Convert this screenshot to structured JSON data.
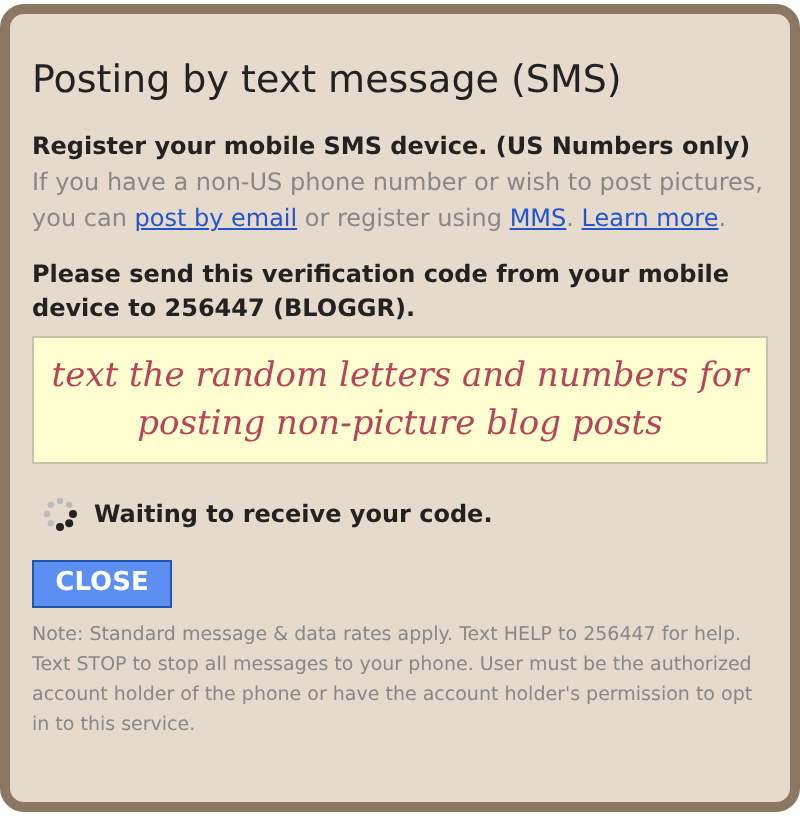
{
  "dialog": {
    "title": "Posting by text message (SMS)",
    "heading": "Register your mobile SMS device. (US Numbers only)",
    "intro": [
      {
        "kind": "text",
        "text": "If you have a non-US phone number or wish to post pictures, you can "
      },
      {
        "kind": "link",
        "text": "post by email"
      },
      {
        "kind": "text",
        "text": " or register using "
      },
      {
        "kind": "link",
        "text": "MMS"
      },
      {
        "kind": "text",
        "text": ". "
      },
      {
        "kind": "link",
        "text": "Learn more"
      },
      {
        "kind": "text",
        "text": "."
      }
    ],
    "instruction": "Please send this verification code from your mobile device to 256447 (BLOGGR).",
    "code_box": {
      "annotation": "text the random letters and numbers for posting non-picture blog posts"
    },
    "status": "Waiting to receive your code.",
    "close_button": "CLOSE",
    "note": "Note: Standard message & data rates apply. Text HELP to 256447 for help. Text STOP to stop all messages to your phone. User must be the authorized account holder of the phone or have the account holder's permission to opt in to this service."
  }
}
